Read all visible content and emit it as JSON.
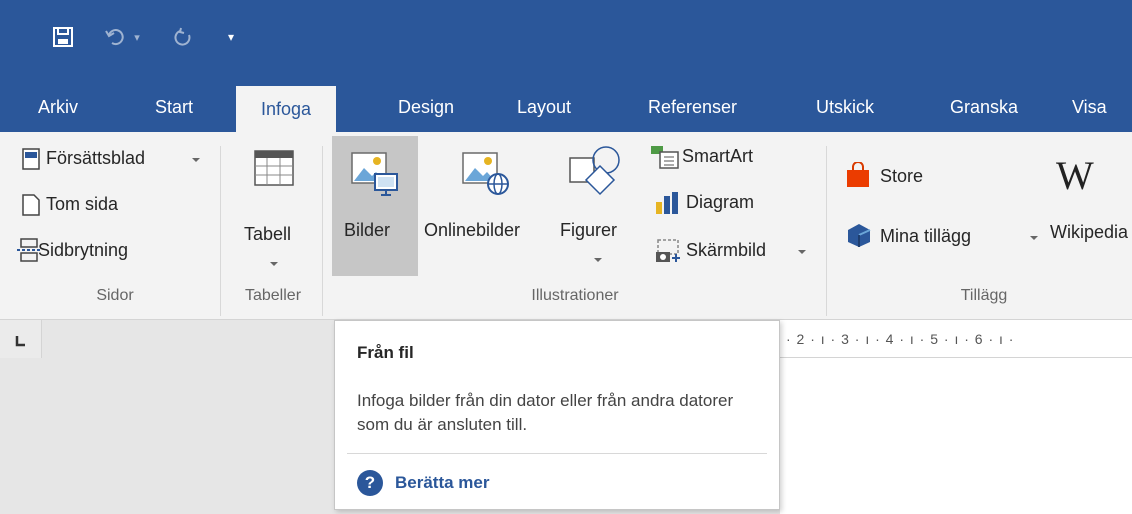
{
  "quick_access": {
    "save_icon": "save-icon",
    "undo_icon": "undo-icon",
    "undo_dropdown": "▾",
    "redo_icon": "redo-icon",
    "customize_icon": "▾"
  },
  "tabs": [
    {
      "label": "Arkiv"
    },
    {
      "label": "Start"
    },
    {
      "label": "Infoga",
      "active": true
    },
    {
      "label": "Design"
    },
    {
      "label": "Layout"
    },
    {
      "label": "Referenser"
    },
    {
      "label": "Utskick"
    },
    {
      "label": "Granska"
    },
    {
      "label": "Visa"
    }
  ],
  "ribbon": {
    "sidor": {
      "group_label": "Sidor",
      "cover_page": "Försättsblad",
      "blank_page": "Tom sida",
      "page_break": "Sidbrytning"
    },
    "tabeller": {
      "group_label": "Tabeller",
      "table": "Tabell"
    },
    "illustrationer": {
      "group_label": "Illustrationer",
      "pictures": "Bilder",
      "online_pictures": "Onlinebilder",
      "shapes": "Figurer",
      "smartart": "SmartArt",
      "chart": "Diagram",
      "screenshot": "Skärmbild"
    },
    "tillagg": {
      "group_label": "Tillägg",
      "store": "Store",
      "my_addins": "Mina tillägg",
      "wikipedia": "Wikipedia"
    }
  },
  "ruler": {
    "text": "· 2 · ı · 3 · ı · 4 · ı · 5 · ı · 6 · ı ·"
  },
  "tooltip": {
    "title": "Från fil",
    "description": "Infoga bilder från din dator eller från andra datorer som du är ansluten till.",
    "more_link": "Berätta mer",
    "help_glyph": "?"
  },
  "colors": {
    "accent": "#2b579a",
    "ribbon_bg": "#f3f3f3",
    "selected_button": "#c6c6c6"
  }
}
